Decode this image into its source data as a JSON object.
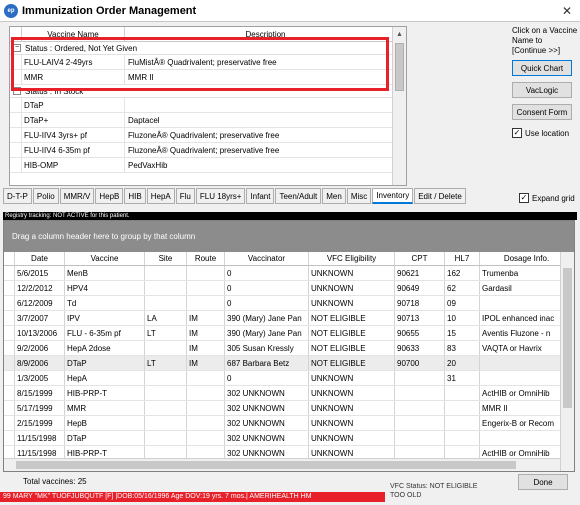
{
  "window": {
    "title": "Immunization Order Management",
    "icon_label": "ep",
    "close_glyph": "✕"
  },
  "top_grid": {
    "col_name": "Vaccine Name",
    "col_desc": "Description",
    "groups": [
      {
        "label": "Status : Ordered, Not Yet Given",
        "toggle": "−",
        "rows": [
          {
            "name": "FLU-LAIV4 2-49yrs",
            "desc": "FluMistÂ® Quadrivalent; preservative free"
          },
          {
            "name": "MMR",
            "desc": "MMR II"
          }
        ]
      },
      {
        "label": "Status : In Stock",
        "toggle": "−",
        "rows": [
          {
            "name": "DTaP",
            "desc": ""
          },
          {
            "name": "DTaP+",
            "desc": "Daptacel"
          },
          {
            "name": "FLU-IIV4 3yrs+ pf",
            "desc": "FluzoneÂ® Quadrivalent; preservative free"
          },
          {
            "name": "FLU-IIV4 6-35m pf",
            "desc": "FluzoneÂ® Quadrivalent; preservative free"
          },
          {
            "name": "HIB-OMP",
            "desc": "PedVaxHib"
          }
        ]
      }
    ]
  },
  "side_panel": {
    "hint": "Click on a Vaccine Name to [Continue >>]",
    "quick_chart": "Quick Chart",
    "vaclogic": "VacLogic",
    "consent": "Consent Form",
    "use_location": "Use location",
    "check_glyph": "✓"
  },
  "tabs": [
    "D-T-P",
    "Polio",
    "MMR/V",
    "HepB",
    "HIB",
    "HepA",
    "Flu",
    "FLU 18yrs+",
    "Infant",
    "Teen/Adult",
    "Men",
    "Misc",
    "Inventory",
    "Edit / Delete"
  ],
  "expand_grid": "Expand grid",
  "registry_text": "Registry tracking: NOT ACTIVE for this patient.",
  "main_grid": {
    "drag_hint": "Drag a column header here to group by that column",
    "headers": [
      "Date",
      "Vaccine",
      "Site",
      "Route",
      "Vaccinator",
      "VFC Eligibility",
      "CPT",
      "HL7",
      "Dosage Info."
    ],
    "rows": [
      [
        "5/6/2015",
        "MenB",
        "",
        "",
        "0",
        "UNKNOWN",
        "90621",
        "162",
        "Trumenba"
      ],
      [
        "12/2/2012",
        "HPV4",
        "",
        "",
        "0",
        "UNKNOWN",
        "90649",
        "62",
        "Gardasil"
      ],
      [
        "6/12/2009",
        "Td",
        "",
        "",
        "0",
        "UNKNOWN",
        "90718",
        "09",
        ""
      ],
      [
        "3/7/2007",
        "IPV",
        "LA",
        "IM",
        "390 (Mary) Jane Pan",
        "NOT ELIGIBLE",
        "90713",
        "10",
        "IPOL enhanced inac"
      ],
      [
        "10/13/2006",
        "FLU - 6-35m pf",
        "LT",
        "IM",
        "390 (Mary) Jane Pan",
        "NOT ELIGIBLE",
        "90655",
        "15",
        "Aventis Fluzone - n"
      ],
      [
        "9/2/2006",
        "HepA 2dose",
        "",
        "IM",
        "305 Susan Kressly",
        "NOT ELIGIBLE",
        "90633",
        "83",
        "VAQTA or Havrix"
      ],
      [
        "8/9/2006",
        "DTaP",
        "LT",
        "IM",
        "687 Barbara Betz",
        "NOT ELIGIBLE",
        "90700",
        "20",
        ""
      ],
      [
        "1/3/2005",
        "HepA",
        "",
        "",
        "0",
        "UNKNOWN",
        "",
        "31",
        ""
      ],
      [
        "8/15/1999",
        "HIB-PRP-T",
        "",
        "",
        "302 UNKNOWN",
        "UNKNOWN",
        "",
        "",
        "ActHIB or OmniHib"
      ],
      [
        "5/17/1999",
        "MMR",
        "",
        "",
        "302 UNKNOWN",
        "UNKNOWN",
        "",
        "",
        "MMR II"
      ],
      [
        "2/15/1999",
        "HepB",
        "",
        "",
        "302 UNKNOWN",
        "UNKNOWN",
        "",
        "",
        "Engerix-B or Recom"
      ],
      [
        "11/15/1998",
        "DTaP",
        "",
        "",
        "302 UNKNOWN",
        "UNKNOWN",
        "",
        "",
        ""
      ],
      [
        "11/15/1998",
        "HIB-PRP-T",
        "",
        "",
        "302 UNKNOWN",
        "UNKNOWN",
        "",
        "",
        "ActHIB or OmniHib"
      ]
    ],
    "selected_row_index": 6
  },
  "footer": {
    "total": "Total vaccines: 25",
    "done": "Done"
  },
  "status_bar": "99 MARY \"MK\" TUOFJUBQUTF [F] |DOB:05/16/1996 Age DOV:19 yrs. 7 mos.| AMERIHEALTH HM",
  "vfc_note": "VFC Status: NOT ELIGIBLE TOO OLD",
  "colors": {
    "highlight": "#e8202a",
    "status_bar": "#e8202a",
    "drag_area": "#8c8c8c",
    "accent": "#0078d7"
  }
}
